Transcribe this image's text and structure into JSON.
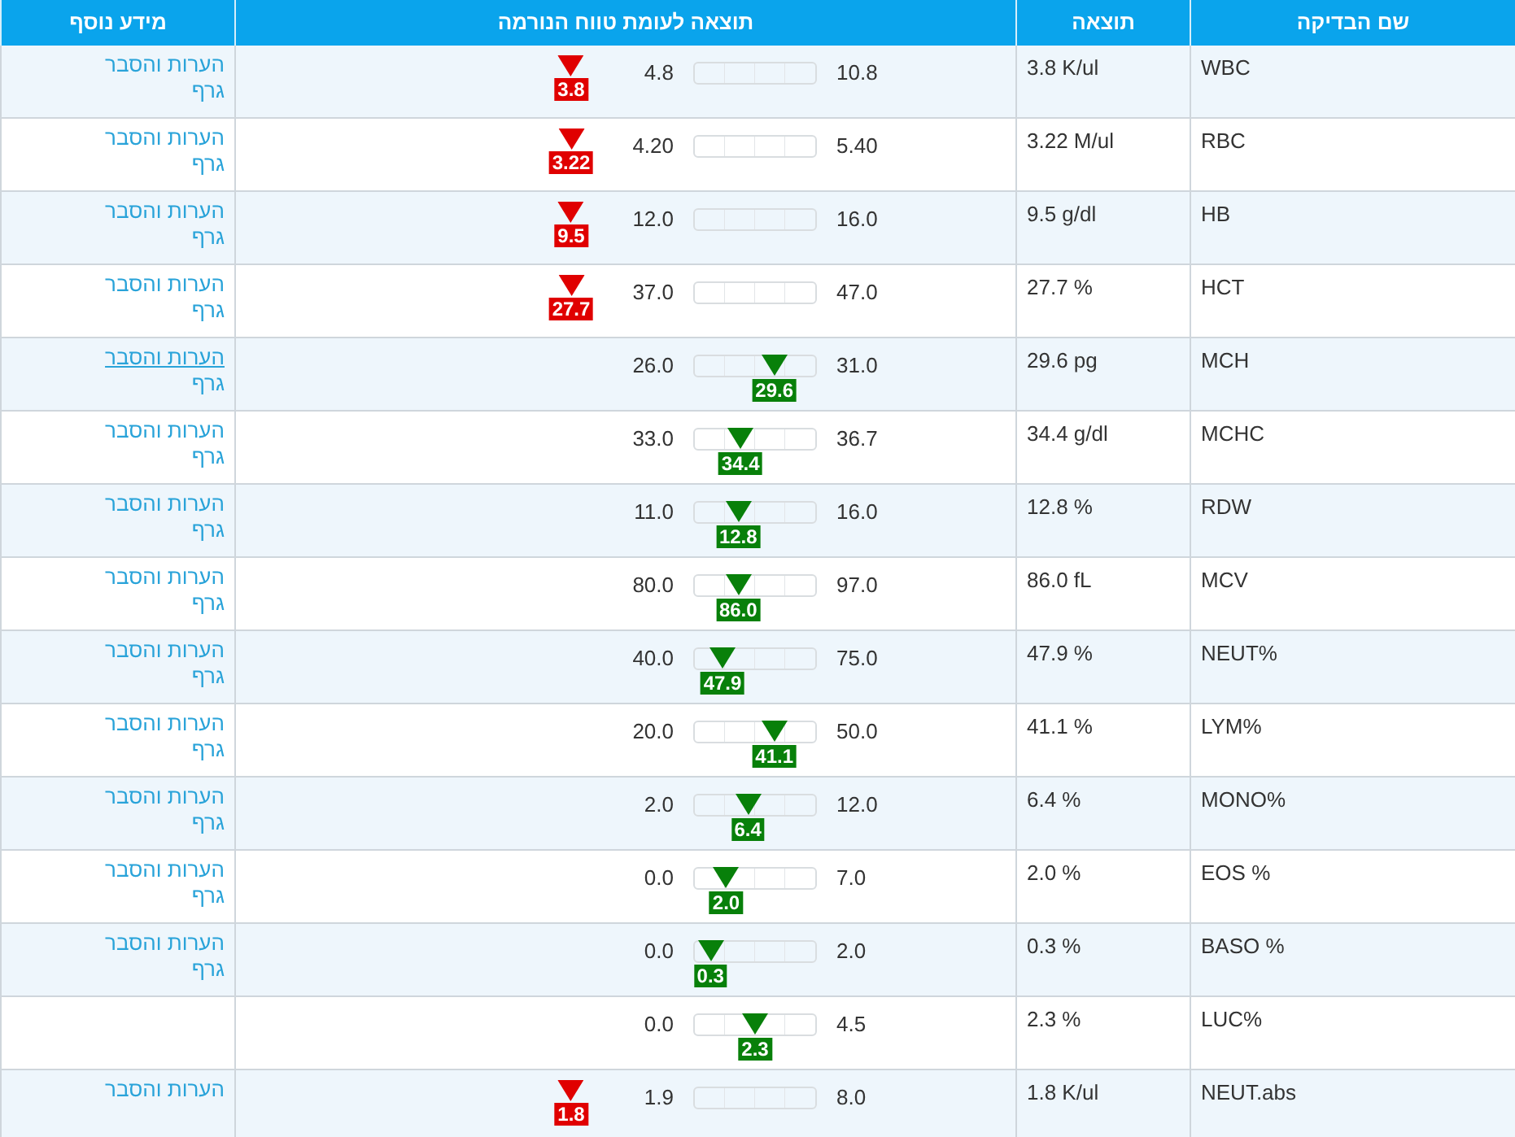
{
  "table": {
    "columns": [
      "שם הבדיקה",
      "תוצאה",
      "תוצאה לעומת טווח הנורמה",
      "מידע נוסף"
    ],
    "rows": [
      {
        "test": "WBC",
        "result": "3.8 K/ul",
        "low": "4.8",
        "high": "10.8",
        "marker": {
          "out_of_range": true,
          "value": "3.8"
        },
        "links": [
          {
            "text": "הערות והסבר",
            "hovered": false
          },
          {
            "text": "גרף",
            "hovered": false
          }
        ]
      },
      {
        "test": "RBC",
        "result": "3.22 M/ul",
        "low": "4.20",
        "high": "5.40",
        "marker": {
          "out_of_range": true,
          "value": "3.22"
        },
        "links": [
          {
            "text": "הערות והסבר",
            "hovered": false
          },
          {
            "text": "גרף",
            "hovered": false
          }
        ]
      },
      {
        "test": "HB",
        "result": "9.5 g/dl",
        "low": "12.0",
        "high": "16.0",
        "marker": {
          "out_of_range": true,
          "value": "9.5"
        },
        "links": [
          {
            "text": "הערות והסבר",
            "hovered": false
          },
          {
            "text": "גרף",
            "hovered": false
          }
        ]
      },
      {
        "test": "HCT",
        "result": "27.7 %",
        "low": "37.0",
        "high": "47.0",
        "marker": {
          "out_of_range": true,
          "value": "27.7"
        },
        "links": [
          {
            "text": "הערות והסבר",
            "hovered": false
          },
          {
            "text": "גרף",
            "hovered": false
          }
        ]
      },
      {
        "test": "MCH",
        "result": "29.6 pg",
        "low": "26.0",
        "high": "31.0",
        "marker": {
          "out_of_range": false,
          "value": "29.6",
          "level": 0.66
        },
        "links": [
          {
            "text": "הערות והסבר",
            "hovered": true
          },
          {
            "text": "גרף",
            "hovered": false
          }
        ]
      },
      {
        "test": "MCHC",
        "result": "34.4 g/dl",
        "low": "33.0",
        "high": "36.7",
        "marker": {
          "out_of_range": false,
          "value": "34.4",
          "level": 0.38
        },
        "links": [
          {
            "text": "הערות והסבר",
            "hovered": false
          },
          {
            "text": "גרף",
            "hovered": false
          }
        ]
      },
      {
        "test": "RDW",
        "result": "12.8 %",
        "low": "11.0",
        "high": "16.0",
        "marker": {
          "out_of_range": false,
          "value": "12.8",
          "level": 0.36
        },
        "links": [
          {
            "text": "הערות והסבר",
            "hovered": false
          },
          {
            "text": "גרף",
            "hovered": false
          }
        ]
      },
      {
        "test": "MCV",
        "result": "86.0 fL",
        "low": "80.0",
        "high": "97.0",
        "marker": {
          "out_of_range": false,
          "value": "86.0",
          "level": 0.36
        },
        "links": [
          {
            "text": "הערות והסבר",
            "hovered": false
          },
          {
            "text": "גרף",
            "hovered": false
          }
        ]
      },
      {
        "test": "NEUT%",
        "result": "47.9 %",
        "low": "40.0",
        "high": "75.0",
        "marker": {
          "out_of_range": false,
          "value": "47.9",
          "level": 0.23
        },
        "links": [
          {
            "text": "הערות והסבר",
            "hovered": false
          },
          {
            "text": "גרף",
            "hovered": false
          }
        ]
      },
      {
        "test": "LYM%",
        "result": "41.1 %",
        "low": "20.0",
        "high": "50.0",
        "marker": {
          "out_of_range": false,
          "value": "41.1",
          "level": 0.66
        },
        "links": [
          {
            "text": "הערות והסבר",
            "hovered": false
          },
          {
            "text": "גרף",
            "hovered": false
          }
        ]
      },
      {
        "test": "MONO%",
        "result": "6.4 %",
        "low": "2.0",
        "high": "12.0",
        "marker": {
          "out_of_range": false,
          "value": "6.4",
          "level": 0.44
        },
        "links": [
          {
            "text": "הערות והסבר",
            "hovered": false
          },
          {
            "text": "גרף",
            "hovered": false
          }
        ]
      },
      {
        "test": "EOS %",
        "result": "2.0 %",
        "low": "0.0",
        "high": "7.0",
        "marker": {
          "out_of_range": false,
          "value": "2.0",
          "level": 0.26
        },
        "links": [
          {
            "text": "הערות והסבר",
            "hovered": false
          },
          {
            "text": "גרף",
            "hovered": false
          }
        ]
      },
      {
        "test": "BASO %",
        "result": "0.3 %",
        "low": "0.0",
        "high": "2.0",
        "marker": {
          "out_of_range": false,
          "value": "0.3",
          "level": 0.13
        },
        "links": [
          {
            "text": "הערות והסבר",
            "hovered": false
          },
          {
            "text": "גרף",
            "hovered": false
          }
        ]
      },
      {
        "test": "LUC%",
        "result": "2.3 %",
        "low": "0.0",
        "high": "4.5",
        "marker": {
          "out_of_range": false,
          "value": "2.3",
          "level": 0.5
        },
        "links": []
      },
      {
        "test": "NEUT.abs",
        "result": "1.8 K/ul",
        "low": "1.9",
        "high": "8.0",
        "marker": {
          "out_of_range": true,
          "value": "1.8"
        },
        "links": [
          {
            "text": "הערות והסבר",
            "hovered": false
          }
        ]
      }
    ]
  }
}
